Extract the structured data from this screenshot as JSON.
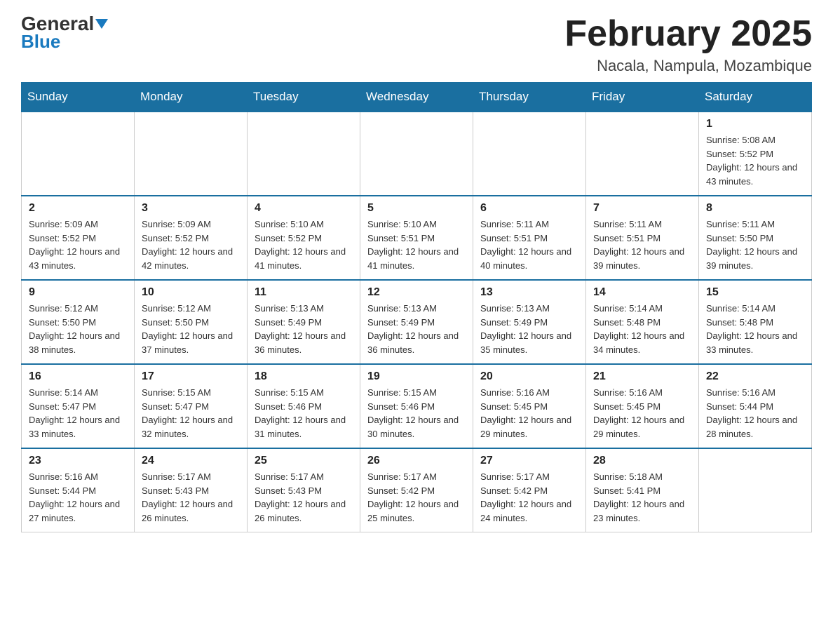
{
  "header": {
    "logo_general": "General",
    "logo_blue": "Blue",
    "month_title": "February 2025",
    "location": "Nacala, Nampula, Mozambique"
  },
  "calendar": {
    "days_of_week": [
      "Sunday",
      "Monday",
      "Tuesday",
      "Wednesday",
      "Thursday",
      "Friday",
      "Saturday"
    ],
    "weeks": [
      [
        {
          "day": "",
          "info": ""
        },
        {
          "day": "",
          "info": ""
        },
        {
          "day": "",
          "info": ""
        },
        {
          "day": "",
          "info": ""
        },
        {
          "day": "",
          "info": ""
        },
        {
          "day": "",
          "info": ""
        },
        {
          "day": "1",
          "info": "Sunrise: 5:08 AM\nSunset: 5:52 PM\nDaylight: 12 hours and 43 minutes."
        }
      ],
      [
        {
          "day": "2",
          "info": "Sunrise: 5:09 AM\nSunset: 5:52 PM\nDaylight: 12 hours and 43 minutes."
        },
        {
          "day": "3",
          "info": "Sunrise: 5:09 AM\nSunset: 5:52 PM\nDaylight: 12 hours and 42 minutes."
        },
        {
          "day": "4",
          "info": "Sunrise: 5:10 AM\nSunset: 5:52 PM\nDaylight: 12 hours and 41 minutes."
        },
        {
          "day": "5",
          "info": "Sunrise: 5:10 AM\nSunset: 5:51 PM\nDaylight: 12 hours and 41 minutes."
        },
        {
          "day": "6",
          "info": "Sunrise: 5:11 AM\nSunset: 5:51 PM\nDaylight: 12 hours and 40 minutes."
        },
        {
          "day": "7",
          "info": "Sunrise: 5:11 AM\nSunset: 5:51 PM\nDaylight: 12 hours and 39 minutes."
        },
        {
          "day": "8",
          "info": "Sunrise: 5:11 AM\nSunset: 5:50 PM\nDaylight: 12 hours and 39 minutes."
        }
      ],
      [
        {
          "day": "9",
          "info": "Sunrise: 5:12 AM\nSunset: 5:50 PM\nDaylight: 12 hours and 38 minutes."
        },
        {
          "day": "10",
          "info": "Sunrise: 5:12 AM\nSunset: 5:50 PM\nDaylight: 12 hours and 37 minutes."
        },
        {
          "day": "11",
          "info": "Sunrise: 5:13 AM\nSunset: 5:49 PM\nDaylight: 12 hours and 36 minutes."
        },
        {
          "day": "12",
          "info": "Sunrise: 5:13 AM\nSunset: 5:49 PM\nDaylight: 12 hours and 36 minutes."
        },
        {
          "day": "13",
          "info": "Sunrise: 5:13 AM\nSunset: 5:49 PM\nDaylight: 12 hours and 35 minutes."
        },
        {
          "day": "14",
          "info": "Sunrise: 5:14 AM\nSunset: 5:48 PM\nDaylight: 12 hours and 34 minutes."
        },
        {
          "day": "15",
          "info": "Sunrise: 5:14 AM\nSunset: 5:48 PM\nDaylight: 12 hours and 33 minutes."
        }
      ],
      [
        {
          "day": "16",
          "info": "Sunrise: 5:14 AM\nSunset: 5:47 PM\nDaylight: 12 hours and 33 minutes."
        },
        {
          "day": "17",
          "info": "Sunrise: 5:15 AM\nSunset: 5:47 PM\nDaylight: 12 hours and 32 minutes."
        },
        {
          "day": "18",
          "info": "Sunrise: 5:15 AM\nSunset: 5:46 PM\nDaylight: 12 hours and 31 minutes."
        },
        {
          "day": "19",
          "info": "Sunrise: 5:15 AM\nSunset: 5:46 PM\nDaylight: 12 hours and 30 minutes."
        },
        {
          "day": "20",
          "info": "Sunrise: 5:16 AM\nSunset: 5:45 PM\nDaylight: 12 hours and 29 minutes."
        },
        {
          "day": "21",
          "info": "Sunrise: 5:16 AM\nSunset: 5:45 PM\nDaylight: 12 hours and 29 minutes."
        },
        {
          "day": "22",
          "info": "Sunrise: 5:16 AM\nSunset: 5:44 PM\nDaylight: 12 hours and 28 minutes."
        }
      ],
      [
        {
          "day": "23",
          "info": "Sunrise: 5:16 AM\nSunset: 5:44 PM\nDaylight: 12 hours and 27 minutes."
        },
        {
          "day": "24",
          "info": "Sunrise: 5:17 AM\nSunset: 5:43 PM\nDaylight: 12 hours and 26 minutes."
        },
        {
          "day": "25",
          "info": "Sunrise: 5:17 AM\nSunset: 5:43 PM\nDaylight: 12 hours and 26 minutes."
        },
        {
          "day": "26",
          "info": "Sunrise: 5:17 AM\nSunset: 5:42 PM\nDaylight: 12 hours and 25 minutes."
        },
        {
          "day": "27",
          "info": "Sunrise: 5:17 AM\nSunset: 5:42 PM\nDaylight: 12 hours and 24 minutes."
        },
        {
          "day": "28",
          "info": "Sunrise: 5:18 AM\nSunset: 5:41 PM\nDaylight: 12 hours and 23 minutes."
        },
        {
          "day": "",
          "info": ""
        }
      ]
    ]
  }
}
